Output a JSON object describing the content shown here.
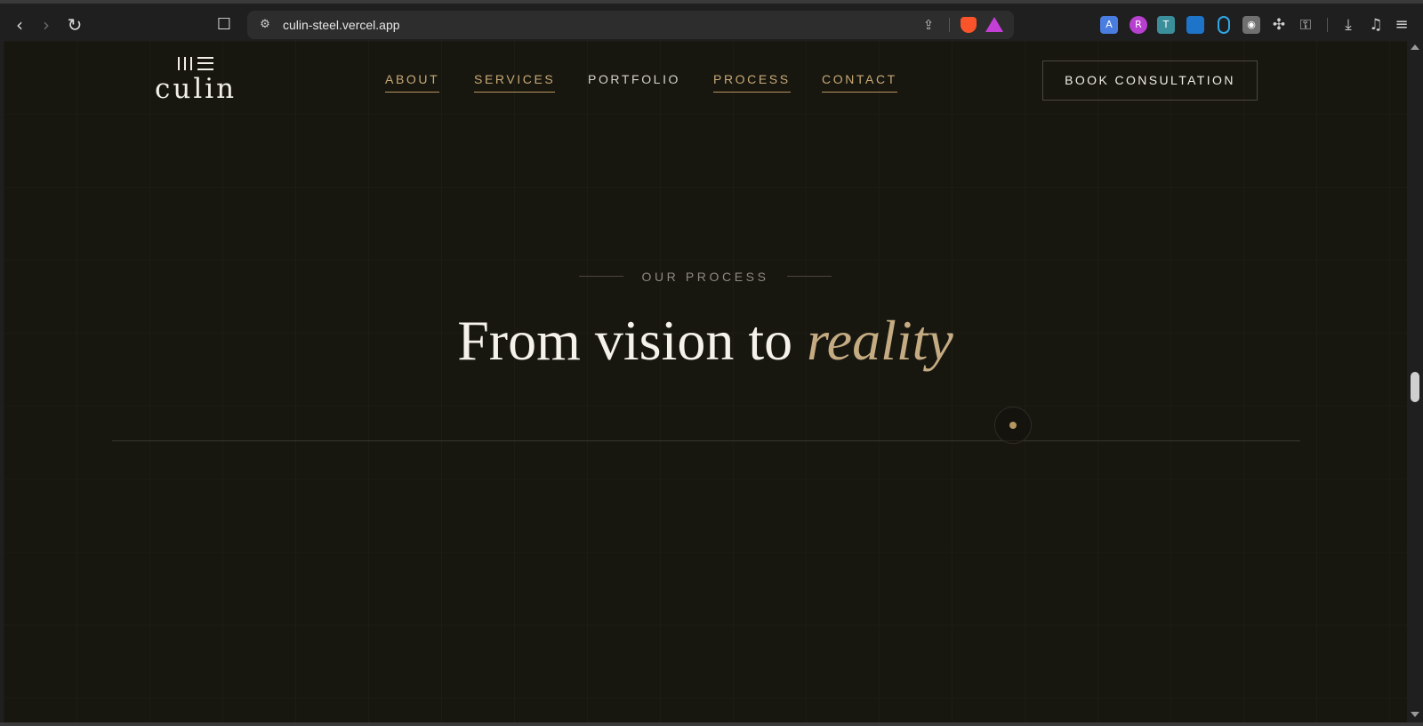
{
  "browser": {
    "back_glyph": "‹",
    "forward_glyph": "›",
    "reload_glyph": "↻",
    "bookmark_glyph": "🔖",
    "url": "culin-steel.vercel.app",
    "icons": [
      "back-icon",
      "forward-icon",
      "reload-icon",
      "bookmark-icon",
      "site-settings-icon",
      "share-icon",
      "brave-shields-icon",
      "brave-rewards-icon",
      "translate-extension-icon",
      "lr-extension-icon",
      "tt-extension-icon",
      "blue-extension-icon",
      "ring-extension-icon",
      "camera-extension-icon",
      "extensions-puzzle-icon",
      "password-key-icon",
      "downloads-icon",
      "media-icon",
      "menu-icon"
    ]
  },
  "site": {
    "logo_text": "culin",
    "nav": {
      "about": "ABOUT",
      "services": "SERVICES",
      "portfolio": "PORTFOLIO",
      "process": "PROCESS",
      "contact": "CONTACT"
    },
    "cta_label": "BOOK CONSULTATION",
    "section": {
      "eyebrow": "OUR PROCESS",
      "headline_main": "From vision to ",
      "headline_accent": "reality"
    }
  },
  "colors": {
    "background": "#17160f",
    "accent_gold": "#c5ab82",
    "nav_active": "#c9ab77",
    "text_light": "#f5f2ea",
    "muted": "#8e8a80"
  }
}
